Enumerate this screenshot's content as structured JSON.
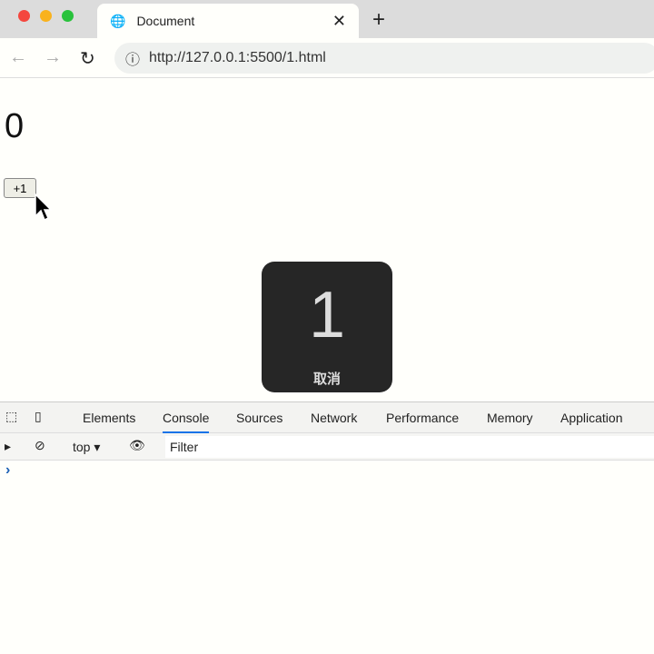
{
  "browser": {
    "tab_title": "Document",
    "url": "http://127.0.0.1:5500/1.html"
  },
  "page": {
    "count": "0",
    "button_label": "+1"
  },
  "toast": {
    "number": "1",
    "cancel_label": "取消"
  },
  "devtools": {
    "tabs": [
      "Elements",
      "Console",
      "Sources",
      "Network",
      "Performance",
      "Memory",
      "Application"
    ],
    "active_tab": "Console",
    "context": "top",
    "filter_placeholder": "Filter",
    "prompt": "›"
  }
}
